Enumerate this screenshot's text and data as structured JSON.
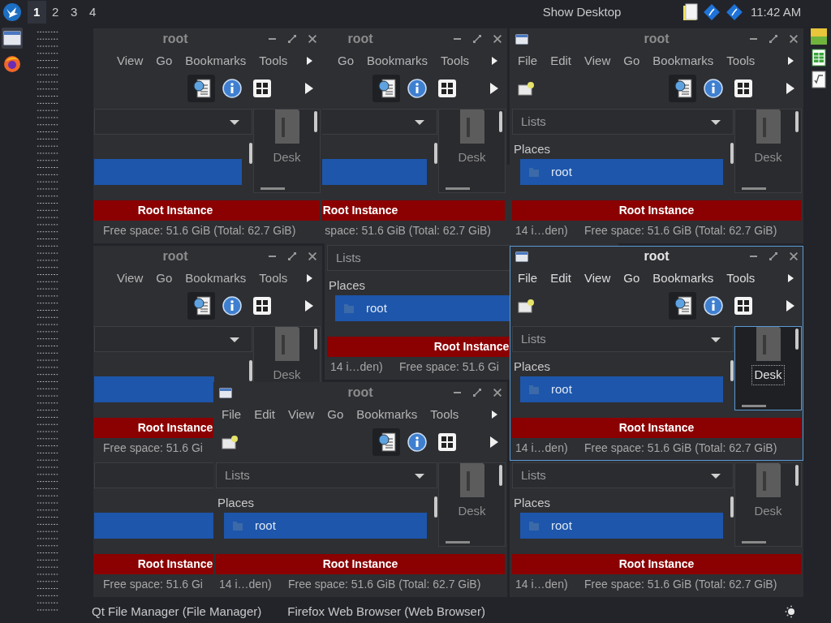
{
  "top_panel": {
    "workspaces": [
      {
        "label": "1",
        "selected": true
      },
      {
        "label": "2",
        "selected": false
      },
      {
        "label": "3",
        "selected": false
      },
      {
        "label": "4",
        "selected": false
      }
    ],
    "show_desktop": "Show Desktop",
    "clock": "11:42 AM"
  },
  "left_dock": [
    {
      "kind": "window",
      "selected": true
    },
    {
      "kind": "browser",
      "selected": false
    }
  ],
  "right_dock": [
    {
      "kind": "qt"
    },
    {
      "kind": "spreadsheet"
    },
    {
      "kind": "formula"
    }
  ],
  "windows": [
    {
      "title": "root",
      "active": false,
      "menu": [
        "View",
        "Go",
        "Bookmarks",
        "Tools"
      ],
      "place": {
        "selected": true
      },
      "preview": "Desk",
      "banner": "Root Instance",
      "free_space": "Free space: 51.6 GiB (Total: 62.7 GiB)"
    },
    {
      "title": "root",
      "active": false,
      "menu": [
        "Go",
        "Bookmarks",
        "Tools"
      ],
      "place": {
        "selected": true
      },
      "preview": "Desk",
      "banner": "Root Instance",
      "free_space": "space: 51.6 GiB (Total: 62.7 GiB)"
    },
    {
      "title": "root",
      "active": false,
      "menu": [
        "File",
        "Edit",
        "View",
        "Go",
        "Bookmarks",
        "Tools"
      ],
      "lists": "Lists",
      "places": "Places",
      "place": {
        "label": "root",
        "selected": true
      },
      "preview": "Desk",
      "banner": "Root Instance",
      "items": "14 i…den)",
      "free_space": "Free space: 51.6 GiB (Total: 62.7 GiB)"
    },
    {
      "title": "root",
      "active": false,
      "menu": [
        "View",
        "Go",
        "Bookmarks",
        "Tools"
      ],
      "place": {
        "selected": true
      },
      "preview": "Desk",
      "banner": "Root Instance",
      "free_space": "Free space: 51.6 Gi"
    },
    {
      "active": false,
      "lists": "Lists",
      "places": "Places",
      "place": {
        "label": "root",
        "selected": true
      },
      "banner": "Root Instance",
      "items": "14 i…den)",
      "free_space": "Free space: 51.6 Gi"
    },
    {
      "title": "root",
      "active": true,
      "menu": [
        "File",
        "Edit",
        "View",
        "Go",
        "Bookmarks",
        "Tools"
      ],
      "lists": "Lists",
      "places": "Places",
      "place": {
        "label": "root",
        "selected": true
      },
      "preview": "Desk",
      "banner": "Root Instance",
      "items": "14 i…den)",
      "free_space": "Free space: 51.6 GiB (Total: 62.7 GiB)"
    },
    {
      "active": false,
      "place": {
        "selected": true
      },
      "banner": "Root Instance",
      "free_space": "Free space: 51.6 Gi"
    },
    {
      "title": "root",
      "active": false,
      "menu": [
        "File",
        "Edit",
        "View",
        "Go",
        "Bookmarks",
        "Tools"
      ],
      "lists": "Lists",
      "places": "Places",
      "place": {
        "label": "root",
        "selected": true
      },
      "preview": "Desk",
      "banner": "Root Instance",
      "items": "14 i…den)",
      "free_space": "Free space: 51.6 GiB (Total: 62.7 GiB)"
    },
    {
      "active": false,
      "lists": "Lists",
      "places": "Places",
      "place": {
        "label": "root",
        "selected": true
      },
      "preview": "Desk",
      "banner": "Root Instance",
      "items": "14 i…den)",
      "free_space": "Free space: 51.6 GiB (Total: 62.7 GiB)"
    }
  ],
  "taskbar": [
    {
      "label": "Qt File Manager (File Manager)"
    },
    {
      "label": "Firefox Web Browser (Web Browser)"
    }
  ]
}
